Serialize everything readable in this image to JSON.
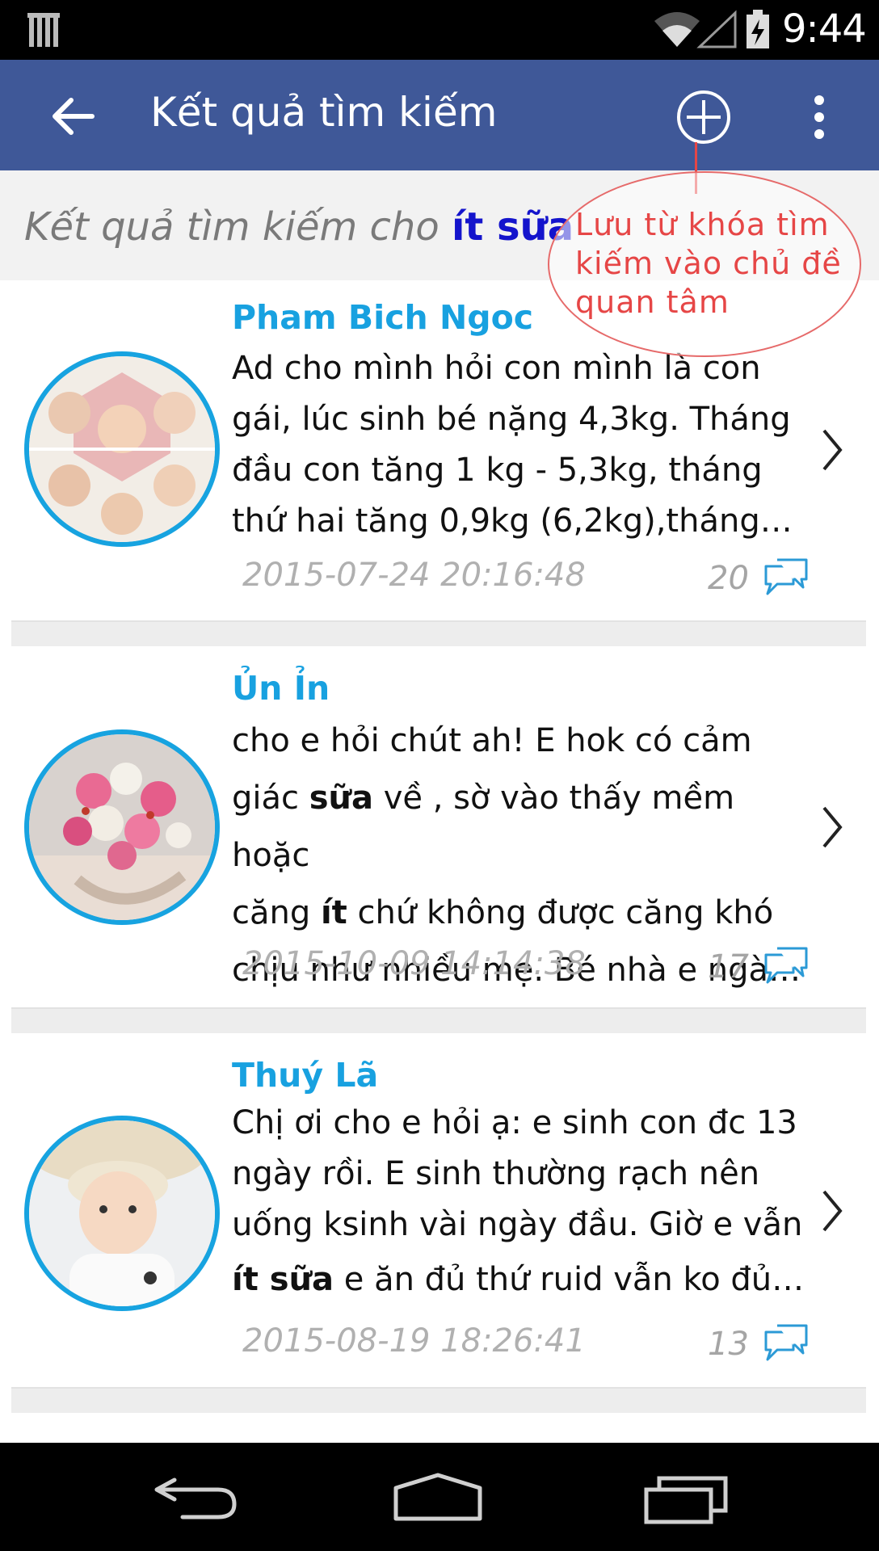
{
  "status_bar": {
    "time": "9:44"
  },
  "action_bar": {
    "title": "Kết quả tìm kiếm"
  },
  "search": {
    "prefix": "Kết quả tìm kiếm cho ",
    "term": "ít sữa"
  },
  "tooltip": {
    "text": "Lưu từ khóa tìm kiếm vào chủ đề quan tâm"
  },
  "posts": [
    {
      "author": "Pham Bich Ngoc",
      "lines": [
        "Ad cho mình hỏi con mình là con",
        "gái, lúc sinh bé nặng 4,3kg. Tháng",
        "đầu con tăng 1 kg - 5,3kg, tháng",
        "thứ hai tăng 0,9kg (6,2kg),tháng…"
      ],
      "date": "2015-07-24 20:16:48",
      "comments": "20"
    },
    {
      "author": "Ủn Ỉn",
      "line1": "cho e hỏi chút ah! E hok có cảm",
      "line2_a": "giác ",
      "line2_b": "sữa",
      "line2_c": " về , sờ vào thấy mềm hoặc",
      "line3_a": "căng ",
      "line3_b": "ít",
      "line3_c": " chứ không được căng khó",
      "line4": "chịu như nhiều mẹ. Bé nhà e ngà…",
      "date": "2015-10-09 14:14:38",
      "comments": "17"
    },
    {
      "author": "Thuý Lã",
      "line1": "Chị ơi cho e hỏi ạ: e sinh con đc 13",
      "line2": "ngày rồi. E sinh thường rạch nên",
      "line3": "uống ksinh vài ngày đầu. Giờ e vẫn",
      "line4_b": "ít sữa",
      "line4_c": " e ăn đủ thứ ruid vẫn ko đủ…",
      "date": "2015-08-19 18:26:41",
      "comments": "13"
    }
  ]
}
